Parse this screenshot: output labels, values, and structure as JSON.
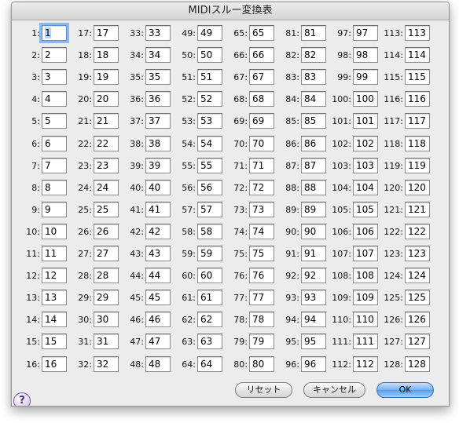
{
  "window": {
    "title": "MIDIスルー変換表"
  },
  "mappings": [
    [
      "1",
      "1"
    ],
    [
      "2",
      "2"
    ],
    [
      "3",
      "3"
    ],
    [
      "4",
      "4"
    ],
    [
      "5",
      "5"
    ],
    [
      "6",
      "6"
    ],
    [
      "7",
      "7"
    ],
    [
      "8",
      "8"
    ],
    [
      "9",
      "9"
    ],
    [
      "10",
      "10"
    ],
    [
      "11",
      "11"
    ],
    [
      "12",
      "12"
    ],
    [
      "13",
      "13"
    ],
    [
      "14",
      "14"
    ],
    [
      "15",
      "15"
    ],
    [
      "16",
      "16"
    ],
    [
      "17",
      "17"
    ],
    [
      "18",
      "18"
    ],
    [
      "19",
      "19"
    ],
    [
      "20",
      "20"
    ],
    [
      "21",
      "21"
    ],
    [
      "22",
      "22"
    ],
    [
      "23",
      "23"
    ],
    [
      "24",
      "24"
    ],
    [
      "25",
      "25"
    ],
    [
      "26",
      "26"
    ],
    [
      "27",
      "27"
    ],
    [
      "28",
      "28"
    ],
    [
      "29",
      "29"
    ],
    [
      "30",
      "30"
    ],
    [
      "31",
      "31"
    ],
    [
      "32",
      "32"
    ],
    [
      "33",
      "33"
    ],
    [
      "34",
      "34"
    ],
    [
      "35",
      "35"
    ],
    [
      "36",
      "36"
    ],
    [
      "37",
      "37"
    ],
    [
      "38",
      "38"
    ],
    [
      "39",
      "39"
    ],
    [
      "40",
      "40"
    ],
    [
      "41",
      "41"
    ],
    [
      "42",
      "42"
    ],
    [
      "43",
      "43"
    ],
    [
      "44",
      "44"
    ],
    [
      "45",
      "45"
    ],
    [
      "46",
      "46"
    ],
    [
      "47",
      "47"
    ],
    [
      "48",
      "48"
    ],
    [
      "49",
      "49"
    ],
    [
      "50",
      "50"
    ],
    [
      "51",
      "51"
    ],
    [
      "52",
      "52"
    ],
    [
      "53",
      "53"
    ],
    [
      "54",
      "54"
    ],
    [
      "55",
      "55"
    ],
    [
      "56",
      "56"
    ],
    [
      "57",
      "57"
    ],
    [
      "58",
      "58"
    ],
    [
      "59",
      "59"
    ],
    [
      "60",
      "60"
    ],
    [
      "61",
      "61"
    ],
    [
      "62",
      "62"
    ],
    [
      "63",
      "63"
    ],
    [
      "64",
      "64"
    ],
    [
      "65",
      "65"
    ],
    [
      "66",
      "66"
    ],
    [
      "67",
      "67"
    ],
    [
      "68",
      "68"
    ],
    [
      "69",
      "69"
    ],
    [
      "70",
      "70"
    ],
    [
      "71",
      "71"
    ],
    [
      "72",
      "72"
    ],
    [
      "73",
      "73"
    ],
    [
      "74",
      "74"
    ],
    [
      "75",
      "75"
    ],
    [
      "76",
      "76"
    ],
    [
      "77",
      "77"
    ],
    [
      "78",
      "78"
    ],
    [
      "79",
      "79"
    ],
    [
      "80",
      "80"
    ],
    [
      "81",
      "81"
    ],
    [
      "82",
      "82"
    ],
    [
      "83",
      "83"
    ],
    [
      "84",
      "84"
    ],
    [
      "85",
      "85"
    ],
    [
      "86",
      "86"
    ],
    [
      "87",
      "87"
    ],
    [
      "88",
      "88"
    ],
    [
      "89",
      "89"
    ],
    [
      "90",
      "90"
    ],
    [
      "91",
      "91"
    ],
    [
      "92",
      "92"
    ],
    [
      "93",
      "93"
    ],
    [
      "94",
      "94"
    ],
    [
      "95",
      "95"
    ],
    [
      "96",
      "96"
    ],
    [
      "97",
      "97"
    ],
    [
      "98",
      "98"
    ],
    [
      "99",
      "99"
    ],
    [
      "100",
      "100"
    ],
    [
      "101",
      "101"
    ],
    [
      "102",
      "102"
    ],
    [
      "103",
      "103"
    ],
    [
      "104",
      "104"
    ],
    [
      "105",
      "105"
    ],
    [
      "106",
      "106"
    ],
    [
      "107",
      "107"
    ],
    [
      "108",
      "108"
    ],
    [
      "109",
      "109"
    ],
    [
      "110",
      "110"
    ],
    [
      "111",
      "111"
    ],
    [
      "112",
      "112"
    ],
    [
      "113",
      "113"
    ],
    [
      "114",
      "114"
    ],
    [
      "115",
      "115"
    ],
    [
      "116",
      "116"
    ],
    [
      "117",
      "117"
    ],
    [
      "118",
      "118"
    ],
    [
      "119",
      "119"
    ],
    [
      "120",
      "120"
    ],
    [
      "121",
      "121"
    ],
    [
      "122",
      "122"
    ],
    [
      "123",
      "123"
    ],
    [
      "124",
      "124"
    ],
    [
      "125",
      "125"
    ],
    [
      "126",
      "126"
    ],
    [
      "127",
      "127"
    ],
    [
      "128",
      "128"
    ]
  ],
  "label_suffix": ":",
  "buttons": {
    "reset": "リセット",
    "cancel": "キャンセル",
    "ok": "OK"
  },
  "help": {
    "glyph": "?",
    "icon": "help-icon"
  },
  "colors": {
    "accent": "#5b9be8",
    "focus_ring": "#8fb7ec"
  }
}
